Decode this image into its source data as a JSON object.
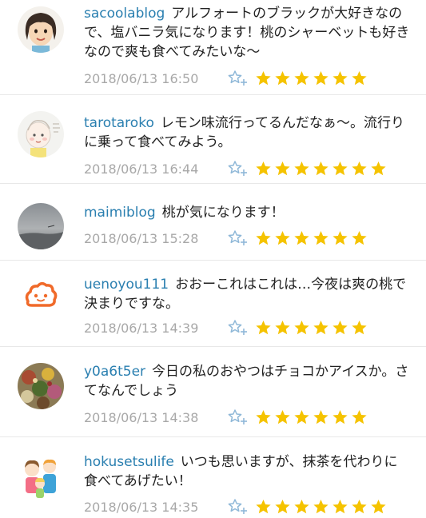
{
  "comments": [
    {
      "username": "sacoolablog",
      "text": "アルフォートのブラックが大好きなので、塩バニラ気になります！桃のシャーベットも好きなので爽も食べてみたいな〜",
      "timestamp": "2018/06/13 16:50",
      "stars": 6,
      "avatar_icon": "woman-face-avatar"
    },
    {
      "username": "tarotaroko",
      "text": "レモン味流行ってるんだなぁ〜。流行りに乗って食べてみよう。",
      "timestamp": "2018/06/13 16:44",
      "stars": 7,
      "avatar_icon": "baby-illustration-avatar"
    },
    {
      "username": "maimiblog",
      "text": "桃が気になります！",
      "timestamp": "2018/06/13 15:28",
      "stars": 6,
      "avatar_icon": "sky-photo-avatar"
    },
    {
      "username": "uenoyou111",
      "text": "おおーこれはこれは…今夜は爽の桃で決まりですな。",
      "timestamp": "2018/06/13 14:39",
      "stars": 6,
      "avatar_icon": "cloud-face-avatar"
    },
    {
      "username": "y0a6t5er",
      "text": "今日の私のおやつはチョコかアイスか。さてなんでしょう",
      "timestamp": "2018/06/13 14:38",
      "stars": 6,
      "avatar_icon": "food-photo-avatar"
    },
    {
      "username": "hokusetsulife",
      "text": "いつも思いますが、抹茶を代わりに食べてあげたい！",
      "timestamp": "2018/06/13 14:35",
      "stars": 7,
      "avatar_icon": "family-illustration-avatar"
    }
  ],
  "colors": {
    "username": "#2a7fb0",
    "timestamp": "#a8a8a8",
    "star": "#f5c300",
    "star_add": "#8fb8d8"
  },
  "icons": {
    "add_star": "add-star-icon",
    "star": "star-icon"
  }
}
